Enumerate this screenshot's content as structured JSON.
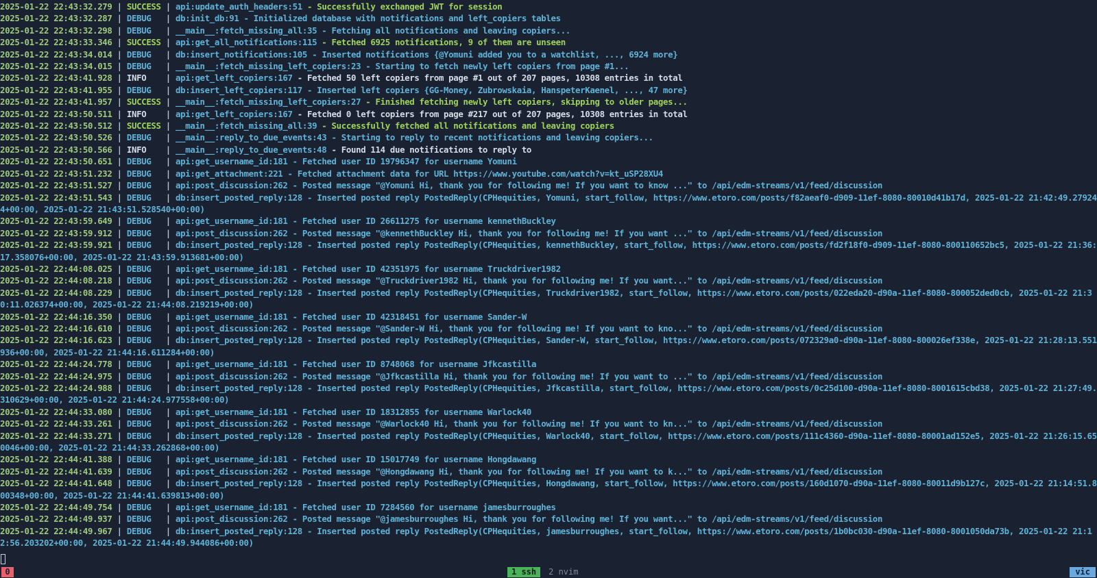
{
  "terminal": {
    "lines": [
      {
        "time": "2025-01-22 22:43:32.279",
        "level": "SUCCESS",
        "source": "api:update_auth_headers:51",
        "message": "Successfully exchanged JWT for session"
      },
      {
        "time": "2025-01-22 22:43:32.287",
        "level": "DEBUG",
        "source": "db:init_db:91",
        "message": "Initialized database with notifications and left_copiers tables"
      },
      {
        "time": "2025-01-22 22:43:32.298",
        "level": "DEBUG",
        "source": "__main__:fetch_missing_all:35",
        "message": "Fetching all notifications and leaving copiers..."
      },
      {
        "time": "2025-01-22 22:43:33.346",
        "level": "SUCCESS",
        "source": "api:get_all_notifications:115",
        "message": "Fetched 6925 notifications, 9 of them are unseen"
      },
      {
        "time": "2025-01-22 22:43:34.014",
        "level": "DEBUG",
        "source": "db:insert_notifications:105",
        "message": "Inserted notifications {@Yomuni added you to a watchlist, ..., 6924 more}"
      },
      {
        "time": "2025-01-22 22:43:34.015",
        "level": "DEBUG",
        "source": "__main__:fetch_missing_left_copiers:23",
        "message": "Starting to fetch newly left copiers from page #1..."
      },
      {
        "time": "2025-01-22 22:43:41.928",
        "level": "INFO",
        "source": "api:get_left_copiers:167",
        "message": "Fetched 50 left copiers from page #1 out of 207 pages, 10308 entries in total"
      },
      {
        "time": "2025-01-22 22:43:41.955",
        "level": "DEBUG",
        "source": "db:insert_left_copiers:117",
        "message": "Inserted left copiers {GG-Money, Zubrowskaia, HanspeterKaenel, ..., 47 more}"
      },
      {
        "time": "2025-01-22 22:43:41.957",
        "level": "SUCCESS",
        "source": "__main__:fetch_missing_left_copiers:27",
        "message": "Finished fetching newly left copiers, skipping to older pages..."
      },
      {
        "time": "2025-01-22 22:43:50.511",
        "level": "INFO",
        "source": "api:get_left_copiers:167",
        "message": "Fetched 0 left copiers from page #217 out of 207 pages, 10308 entries in total"
      },
      {
        "time": "2025-01-22 22:43:50.512",
        "level": "SUCCESS",
        "source": "__main__:fetch_missing_all:39",
        "message": "Successfully fetched all notifications and leaving copiers"
      },
      {
        "time": "2025-01-22 22:43:50.526",
        "level": "DEBUG",
        "source": "__main__:reply_to_due_events:43",
        "message": "Starting to reply to recent notifications and leaving copiers..."
      },
      {
        "time": "2025-01-22 22:43:50.566",
        "level": "INFO",
        "source": "__main__:reply_to_due_events:48",
        "message": "Found 114 due notifications to reply to"
      },
      {
        "time": "2025-01-22 22:43:50.651",
        "level": "DEBUG",
        "source": "api:get_username_id:181",
        "message": "Fetched user ID 19796347 for username Yomuni"
      },
      {
        "time": "2025-01-22 22:43:51.232",
        "level": "DEBUG",
        "source": "api:get_attachment:221",
        "message": "Fetched attachment data for URL https://www.youtube.com/watch?v=kt_uSP28XU4"
      },
      {
        "time": "2025-01-22 22:43:51.527",
        "level": "DEBUG",
        "source": "api:post_discussion:262",
        "message": "Posted message \"@Yomuni Hi, thank you for following me! If you want to know ...\" to /api/edm-streams/v1/feed/discussion"
      },
      {
        "time": "2025-01-22 22:43:51.543",
        "level": "DEBUG",
        "source": "db:insert_posted_reply:128",
        "message": "Inserted posted reply PostedReply(CPHequities, Yomuni, start_follow, https://www.etoro.com/posts/f82aeaf0-d909-11ef-8080-80010d41b17d, 2025-01-22 21:42:49.279244+00:00, 2025-01-22 21:43:51.528540+00:00)"
      },
      {
        "time": "2025-01-22 22:43:59.649",
        "level": "DEBUG",
        "source": "api:get_username_id:181",
        "message": "Fetched user ID 26611275 for username kennethBuckley"
      },
      {
        "time": "2025-01-22 22:43:59.912",
        "level": "DEBUG",
        "source": "api:post_discussion:262",
        "message": "Posted message \"@kennethBuckley Hi, thank you for following me! If you want ...\" to /api/edm-streams/v1/feed/discussion"
      },
      {
        "time": "2025-01-22 22:43:59.921",
        "level": "DEBUG",
        "source": "db:insert_posted_reply:128",
        "message": "Inserted posted reply PostedReply(CPHequities, kennethBuckley, start_follow, https://www.etoro.com/posts/fd2f18f0-d909-11ef-8080-800110652bc5, 2025-01-22 21:36:17.358076+00:00, 2025-01-22 21:43:59.913681+00:00)"
      },
      {
        "time": "2025-01-22 22:44:08.025",
        "level": "DEBUG",
        "source": "api:get_username_id:181",
        "message": "Fetched user ID 42351975 for username Truckdriver1982"
      },
      {
        "time": "2025-01-22 22:44:08.218",
        "level": "DEBUG",
        "source": "api:post_discussion:262",
        "message": "Posted message \"@Truckdriver1982 Hi, thank you for following me! If you want...\" to /api/edm-streams/v1/feed/discussion"
      },
      {
        "time": "2025-01-22 22:44:08.229",
        "level": "DEBUG",
        "source": "db:insert_posted_reply:128",
        "message": "Inserted posted reply PostedReply(CPHequities, Truckdriver1982, start_follow, https://www.etoro.com/posts/022eda20-d90a-11ef-8080-800052ded0cb, 2025-01-22 21:30:11.026374+00:00, 2025-01-22 21:44:08.219219+00:00)"
      },
      {
        "time": "2025-01-22 22:44:16.350",
        "level": "DEBUG",
        "source": "api:get_username_id:181",
        "message": "Fetched user ID 42318451 for username Sander-W"
      },
      {
        "time": "2025-01-22 22:44:16.610",
        "level": "DEBUG",
        "source": "api:post_discussion:262",
        "message": "Posted message \"@Sander-W Hi, thank you for following me! If you want to kno...\" to /api/edm-streams/v1/feed/discussion"
      },
      {
        "time": "2025-01-22 22:44:16.623",
        "level": "DEBUG",
        "source": "db:insert_posted_reply:128",
        "message": "Inserted posted reply PostedReply(CPHequities, Sander-W, start_follow, https://www.etoro.com/posts/072329a0-d90a-11ef-8080-800026ef338e, 2025-01-22 21:28:13.551936+00:00, 2025-01-22 21:44:16.611284+00:00)"
      },
      {
        "time": "2025-01-22 22:44:24.778",
        "level": "DEBUG",
        "source": "api:get_username_id:181",
        "message": "Fetched user ID 8748068 for username Jfkcastilla"
      },
      {
        "time": "2025-01-22 22:44:24.975",
        "level": "DEBUG",
        "source": "api:post_discussion:262",
        "message": "Posted message \"@Jfkcastilla Hi, thank you for following me! If you want to ...\" to /api/edm-streams/v1/feed/discussion"
      },
      {
        "time": "2025-01-22 22:44:24.988",
        "level": "DEBUG",
        "source": "db:insert_posted_reply:128",
        "message": "Inserted posted reply PostedReply(CPHequities, Jfkcastilla, start_follow, https://www.etoro.com/posts/0c25d100-d90a-11ef-8080-8001615cbd38, 2025-01-22 21:27:49.310629+00:00, 2025-01-22 21:44:24.977558+00:00)"
      },
      {
        "time": "2025-01-22 22:44:33.080",
        "level": "DEBUG",
        "source": "api:get_username_id:181",
        "message": "Fetched user ID 18312855 for username Warlock40"
      },
      {
        "time": "2025-01-22 22:44:33.261",
        "level": "DEBUG",
        "source": "api:post_discussion:262",
        "message": "Posted message \"@Warlock40 Hi, thank you for following me! If you want to kn...\" to /api/edm-streams/v1/feed/discussion"
      },
      {
        "time": "2025-01-22 22:44:33.271",
        "level": "DEBUG",
        "source": "db:insert_posted_reply:128",
        "message": "Inserted posted reply PostedReply(CPHequities, Warlock40, start_follow, https://www.etoro.com/posts/111c4360-d90a-11ef-8080-80001ad152e5, 2025-01-22 21:26:15.650046+00:00, 2025-01-22 21:44:33.262868+00:00)"
      },
      {
        "time": "2025-01-22 22:44:41.388",
        "level": "DEBUG",
        "source": "api:get_username_id:181",
        "message": "Fetched user ID 15017749 for username Hongdawang"
      },
      {
        "time": "2025-01-22 22:44:41.639",
        "level": "DEBUG",
        "source": "api:post_discussion:262",
        "message": "Posted message \"@Hongdawang Hi, thank you for following me! If you want to k...\" to /api/edm-streams/v1/feed/discussion"
      },
      {
        "time": "2025-01-22 22:44:41.648",
        "level": "DEBUG",
        "source": "db:insert_posted_reply:128",
        "message": "Inserted posted reply PostedReply(CPHequities, Hongdawang, start_follow, https://www.etoro.com/posts/160d1070-d90a-11ef-8080-80011d9b127c, 2025-01-22 21:14:51.800348+00:00, 2025-01-22 21:44:41.639813+00:00)"
      },
      {
        "time": "2025-01-22 22:44:49.754",
        "level": "DEBUG",
        "source": "api:get_username_id:181",
        "message": "Fetched user ID 7284560 for username jamesburroughes"
      },
      {
        "time": "2025-01-22 22:44:49.937",
        "level": "DEBUG",
        "source": "api:post_discussion:262",
        "message": "Posted message \"@jamesburroughes Hi, thank you for following me! If you want...\" to /api/edm-streams/v1/feed/discussion"
      },
      {
        "time": "2025-01-22 22:44:49.967",
        "level": "DEBUG",
        "source": "db:insert_posted_reply:128",
        "message": "Inserted posted reply PostedReply(CPHequities, jamesburroughes, start_follow, https://www.etoro.com/posts/1b0bc030-d90a-11ef-8080-8001050da73b, 2025-01-22 21:12:56.203202+00:00, 2025-01-22 21:44:49.944086+00:00)"
      }
    ]
  },
  "statusbar": {
    "session_index": "0",
    "tabs": [
      {
        "label": "1 ssh",
        "active": true
      },
      {
        "label": "2 nvim",
        "active": false
      }
    ],
    "right_label": "vic"
  },
  "colors": {
    "background": "#1a2130",
    "success": "#9fd35a",
    "debug": "#5fb3d8",
    "info": "#d6dde8",
    "timestamp": "#9fc97f",
    "tab_active": "#4bb35a",
    "session_badge": "#e8606a",
    "right_badge": "#6aa8e0"
  }
}
